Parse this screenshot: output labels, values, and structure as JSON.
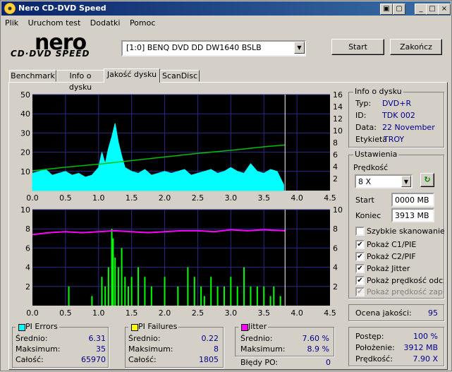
{
  "app": {
    "title": "Nero CD-DVD Speed"
  },
  "menu": [
    "Plik",
    "Uruchom test",
    "Dodatki",
    "Pomoc"
  ],
  "logo": {
    "brand": "nero",
    "product": "CD·DVD SPEED"
  },
  "drive": {
    "selected": "[1:0]  BENQ DVD DD DW1640 BSLB"
  },
  "buttons": {
    "start": "Start",
    "stop": "Zakończ"
  },
  "tabs": [
    "Benchmark",
    "Info o dysku",
    "Jakość dysku",
    "ScanDisc"
  ],
  "disc_info": {
    "title": "Info o dysku",
    "rows": [
      {
        "label": "Typ:",
        "value": "DVD+R"
      },
      {
        "label": "ID:",
        "value": "TDK 002"
      },
      {
        "label": "Data:",
        "value": "22 November"
      },
      {
        "label": "Etykieta",
        "value": "TROY"
      }
    ]
  },
  "settings": {
    "title": "Ustawienia",
    "speed_label": "Prędkość",
    "speed_value": "8 X",
    "start_label": "Start",
    "start_value": "0000 MB",
    "end_label": "Koniec",
    "end_value": "3913 MB",
    "checkboxes": [
      {
        "label": "Szybkie skanowanie",
        "checked": false
      },
      {
        "label": "Pokaż C1/PIE",
        "checked": true
      },
      {
        "label": "Pokaż C2/PIF",
        "checked": true
      },
      {
        "label": "Pokaż Jitter",
        "checked": true
      },
      {
        "label": "Pokaż prędkość odczy",
        "checked": true
      },
      {
        "label": "Pokaż prędkość zapisu",
        "checked": true
      }
    ]
  },
  "quality": {
    "label": "Ocena jakości:",
    "value": "95"
  },
  "pi_errors": {
    "title": "PI Errors",
    "color": "#00ffff",
    "rows": [
      {
        "label": "Średnio:",
        "value": "6.31"
      },
      {
        "label": "Maksimum:",
        "value": "35"
      },
      {
        "label": "Całość:",
        "value": "65970"
      }
    ]
  },
  "pi_failures": {
    "title": "PI Failures",
    "color": "#ffff00",
    "rows": [
      {
        "label": "Średnio:",
        "value": "0.22"
      },
      {
        "label": "Maksimum:",
        "value": "8"
      },
      {
        "label": "Całość:",
        "value": "1805"
      }
    ]
  },
  "jitter": {
    "title": "Jitter",
    "color": "#ff00ff",
    "rows": [
      {
        "label": "Średnio:",
        "value": "7.60 %"
      },
      {
        "label": "Maksimum:",
        "value": "8.9 %"
      }
    ],
    "bledy_label": "Błędy PO:",
    "bledy_value": "0"
  },
  "progress": {
    "rows": [
      {
        "label": "Postęp:",
        "value": "100 %"
      },
      {
        "label": "Położenie:",
        "value": "3912 MB"
      },
      {
        "label": "Prędkość:",
        "value": "7.90 X"
      }
    ]
  },
  "chart_data": [
    {
      "type": "area",
      "x_range": [
        0,
        4.5
      ],
      "x_ticks": [
        "0.0",
        "0.5",
        "1.0",
        "1.5",
        "2.0",
        "2.5",
        "3.0",
        "3.5",
        "4.0",
        "4.5"
      ],
      "y_left_range": [
        0,
        50
      ],
      "y_left_ticks": [
        "50",
        "40",
        "30",
        "20",
        "10"
      ],
      "y_right_range": [
        0,
        16
      ],
      "y_right_ticks": [
        "16",
        "14",
        "12",
        "10",
        "8",
        "6",
        "4",
        "2"
      ],
      "end_marker_x": 3.82,
      "pie_series": {
        "color": "#00ffff",
        "x": [
          0.0,
          0.1,
          0.2,
          0.3,
          0.4,
          0.5,
          0.6,
          0.7,
          0.8,
          0.9,
          1.0,
          1.05,
          1.1,
          1.15,
          1.2,
          1.25,
          1.3,
          1.35,
          1.4,
          1.5,
          1.6,
          1.7,
          1.8,
          1.9,
          2.0,
          2.1,
          2.2,
          2.3,
          2.4,
          2.5,
          2.6,
          2.7,
          2.8,
          2.9,
          3.0,
          3.1,
          3.2,
          3.3,
          3.4,
          3.5,
          3.6,
          3.7,
          3.8
        ],
        "y": [
          9,
          10,
          11,
          8,
          9,
          10,
          8,
          9,
          7,
          8,
          12,
          20,
          14,
          22,
          28,
          35,
          25,
          18,
          12,
          10,
          9,
          11,
          8,
          9,
          10,
          9,
          10,
          11,
          8,
          9,
          10,
          11,
          9,
          10,
          12,
          10,
          9,
          14,
          10,
          9,
          11,
          10,
          3
        ]
      },
      "speed_series": {
        "color": "#00c000",
        "x": [
          0.0,
          0.5,
          1.0,
          1.5,
          2.0,
          2.5,
          3.0,
          3.5,
          3.82
        ],
        "y": [
          3.3,
          3.9,
          4.4,
          5.0,
          5.6,
          6.2,
          6.7,
          7.3,
          7.6
        ]
      }
    },
    {
      "type": "bar",
      "x_range": [
        0,
        4.5
      ],
      "x_ticks": [
        "0.0",
        "0.5",
        "1.0",
        "1.5",
        "2.0",
        "2.5",
        "3.0",
        "3.5",
        "4.0",
        "4.5"
      ],
      "y_left_range": [
        0,
        10
      ],
      "y_left_ticks": [
        "10",
        "8",
        "6",
        "4",
        "2"
      ],
      "y_right_range": [
        0,
        10
      ],
      "y_right_ticks": [
        "10",
        "8",
        "6",
        "4",
        "2"
      ],
      "end_marker_x": 3.82,
      "pif_series": {
        "color": "#00ff00",
        "x": [
          0.55,
          0.9,
          1.05,
          1.1,
          1.15,
          1.2,
          1.22,
          1.25,
          1.3,
          1.35,
          1.4,
          1.45,
          1.5,
          1.6,
          1.7,
          1.8,
          2.0,
          2.2,
          2.35,
          2.45,
          2.55,
          2.6,
          2.7,
          2.8,
          2.9,
          3.0,
          3.1,
          3.2,
          3.3,
          3.4,
          3.5,
          3.6,
          3.65,
          3.75
        ],
        "y": [
          2,
          1,
          3,
          2,
          4,
          8,
          7,
          5,
          4,
          6,
          3,
          2,
          3,
          4,
          3,
          2,
          3,
          2,
          4,
          3,
          2,
          1,
          3,
          2,
          2,
          3,
          2,
          4,
          2,
          2,
          2,
          1,
          2,
          1
        ]
      },
      "jitter_series": {
        "color": "#ff00ff",
        "x": [
          0.0,
          0.25,
          0.5,
          0.75,
          1.0,
          1.25,
          1.5,
          1.75,
          2.0,
          2.25,
          2.5,
          2.75,
          3.0,
          3.25,
          3.5,
          3.82
        ],
        "y": [
          7.4,
          7.6,
          7.7,
          7.6,
          7.7,
          7.8,
          7.7,
          7.6,
          7.7,
          7.8,
          7.8,
          7.7,
          7.9,
          7.8,
          7.9,
          7.8
        ]
      }
    }
  ]
}
